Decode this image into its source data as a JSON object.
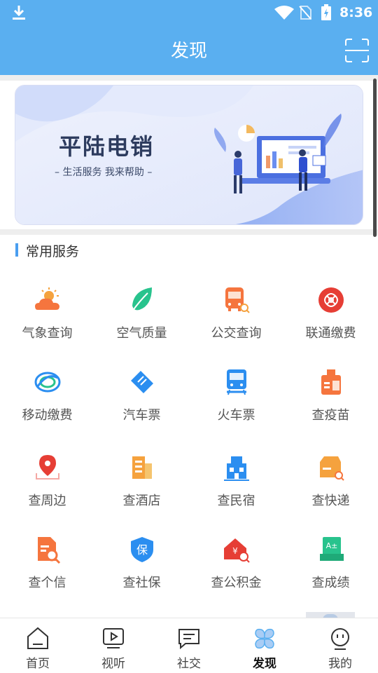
{
  "status_bar": {
    "time": "8:36"
  },
  "header": {
    "title": "发现"
  },
  "banner": {
    "title": "平陆电销",
    "subtitle": "– 生活服务  我来帮助 –"
  },
  "section": {
    "title": "常用服务"
  },
  "services": [
    {
      "label": "气象查询",
      "icon": "weather-icon"
    },
    {
      "label": "空气质量",
      "icon": "leaf-icon"
    },
    {
      "label": "公交查询",
      "icon": "bus-icon"
    },
    {
      "label": "联通缴费",
      "icon": "unicom-icon"
    },
    {
      "label": "移动缴费",
      "icon": "mobile-icon"
    },
    {
      "label": "汽车票",
      "icon": "ticket-icon"
    },
    {
      "label": "火车票",
      "icon": "train-icon"
    },
    {
      "label": "查疫苗",
      "icon": "vaccine-icon"
    },
    {
      "label": "查周边",
      "icon": "location-icon"
    },
    {
      "label": "查酒店",
      "icon": "hotel-icon"
    },
    {
      "label": "查民宿",
      "icon": "homestay-icon"
    },
    {
      "label": "查快递",
      "icon": "express-icon"
    },
    {
      "label": "查个信",
      "icon": "credit-icon"
    },
    {
      "label": "查社保",
      "icon": "social-security-icon"
    },
    {
      "label": "查公积金",
      "icon": "housing-fund-icon"
    },
    {
      "label": "查成绩",
      "icon": "score-icon"
    }
  ],
  "bottom_nav": [
    {
      "label": "首页",
      "icon": "home-icon"
    },
    {
      "label": "视听",
      "icon": "video-icon"
    },
    {
      "label": "社交",
      "icon": "chat-icon"
    },
    {
      "label": "发现",
      "icon": "discover-icon",
      "active": true
    },
    {
      "label": "我的",
      "icon": "profile-icon"
    }
  ],
  "colors": {
    "header": "#5aaff0",
    "accent": "#4a9ef0",
    "icon_orange": "#f5753e",
    "icon_blue": "#2b8ef0",
    "icon_green": "#28c38d",
    "icon_red": "#e63e35"
  }
}
